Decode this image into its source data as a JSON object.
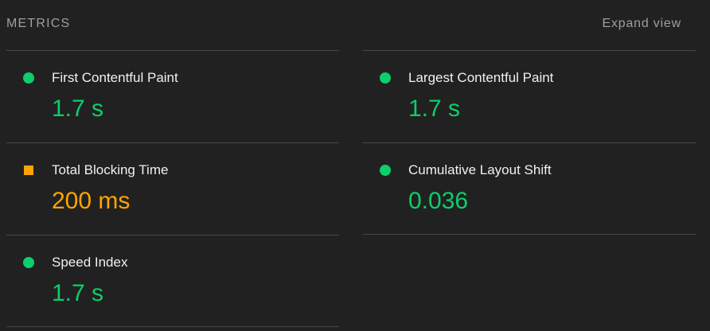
{
  "header": {
    "title": "METRICS",
    "expand_label": "Expand view"
  },
  "colors": {
    "pass": "#0cce6b",
    "average": "#ffa400",
    "label": "#f0f0f0",
    "muted": "#9e9e9e",
    "divider": "#474747",
    "background": "#212121"
  },
  "metrics": [
    {
      "label": "First Contentful Paint",
      "value": "1.7 s",
      "status": "pass",
      "indicator": "green-circle-icon"
    },
    {
      "label": "Largest Contentful Paint",
      "value": "1.7 s",
      "status": "pass",
      "indicator": "green-circle-icon"
    },
    {
      "label": "Total Blocking Time",
      "value": "200 ms",
      "status": "average",
      "indicator": "orange-square-icon"
    },
    {
      "label": "Cumulative Layout Shift",
      "value": "0.036",
      "status": "pass",
      "indicator": "green-circle-icon"
    },
    {
      "label": "Speed Index",
      "value": "1.7 s",
      "status": "pass",
      "indicator": "green-circle-icon"
    }
  ]
}
